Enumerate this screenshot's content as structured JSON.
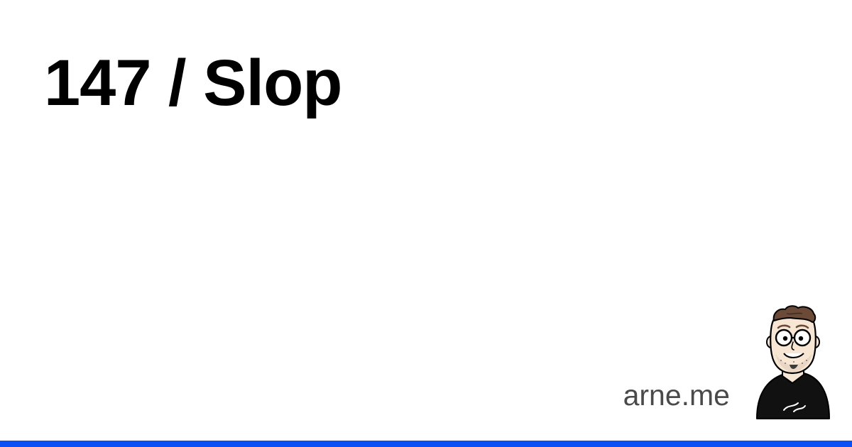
{
  "post": {
    "title": "147 / Slop"
  },
  "footer": {
    "site": "arne.me",
    "avatar_icon": "cartoon-portrait-icon"
  },
  "colors": {
    "background": "#ffffff",
    "title": "#000000",
    "site": "#4a4a4a",
    "accent": "#0a4ff5",
    "shirt": "#111111",
    "hair": "#6b4a38",
    "skin": "#f7e6d3"
  }
}
